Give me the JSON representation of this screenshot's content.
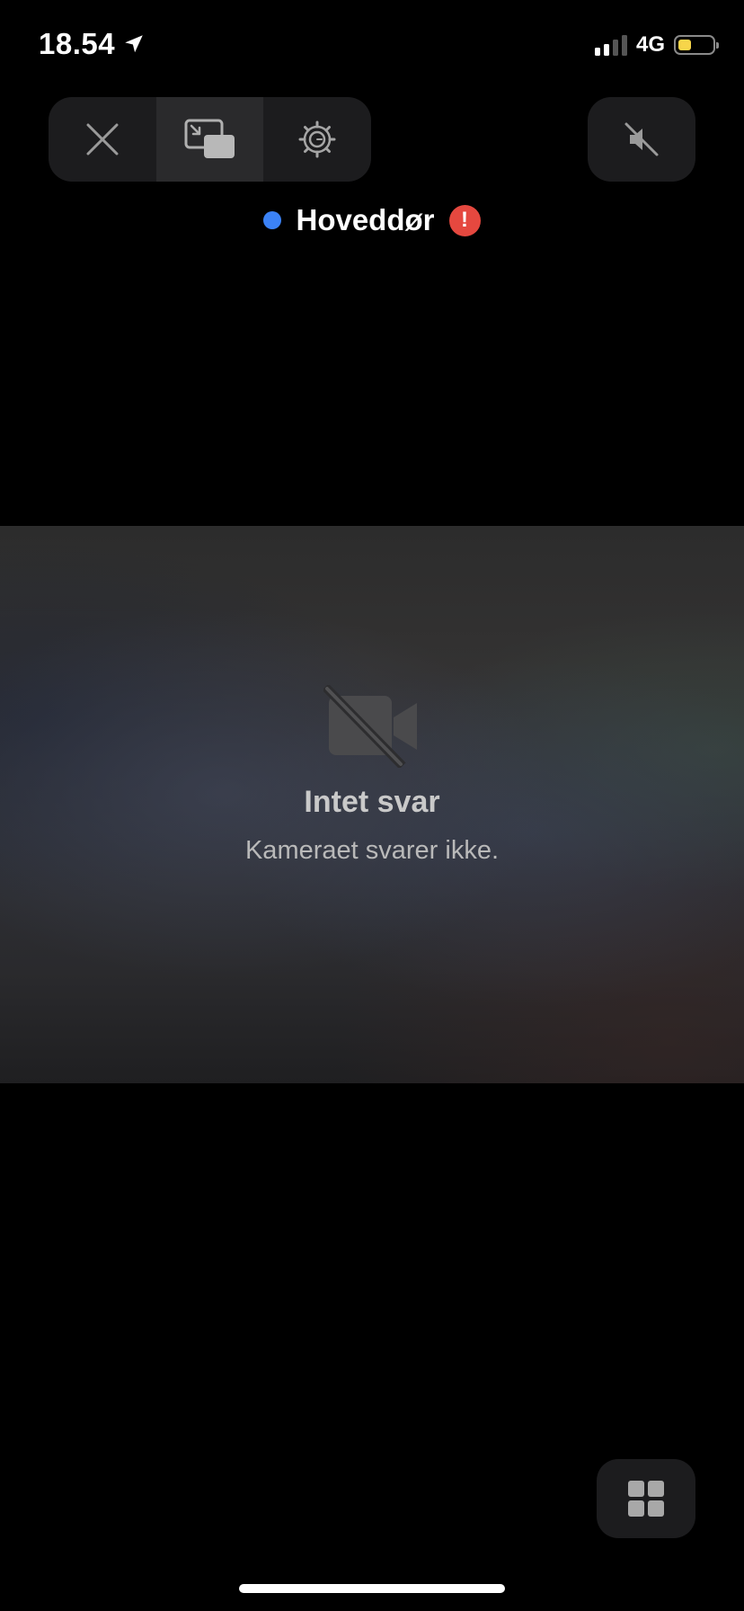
{
  "status_bar": {
    "time": "18.54",
    "network": "4G",
    "signal_bars_active": 2,
    "signal_bars_total": 4,
    "battery_level": 0.4,
    "battery_color": "#f7d54a",
    "location_icon": "location-arrow-icon"
  },
  "toolbar": {
    "close_icon": "close-icon",
    "pip_icon": "picture-in-picture-icon",
    "settings_icon": "gear-icon",
    "mute_icon": "speaker-muted-icon"
  },
  "camera": {
    "name": "Hoveddør",
    "status_dot_color": "#3b82f6",
    "alert_symbol": "!",
    "alert_color": "#e5483f"
  },
  "video": {
    "icon": "video-off-icon",
    "title": "Intet svar",
    "subtitle": "Kameraet svarer ikke."
  },
  "bottom": {
    "grid_icon": "grid-icon"
  }
}
